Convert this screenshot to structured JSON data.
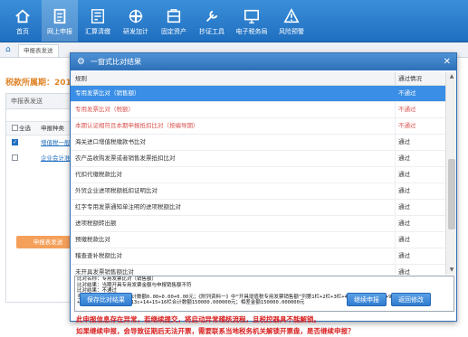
{
  "toolbar": {
    "items": [
      {
        "label": "首页",
        "icon": "home-icon"
      },
      {
        "label": "网上申报",
        "icon": "declare-icon",
        "active": true
      },
      {
        "label": "汇算清缴",
        "icon": "settlement-icon"
      },
      {
        "label": "研发加计",
        "icon": "rd-icon"
      },
      {
        "label": "固定资产",
        "icon": "asset-icon"
      },
      {
        "label": "抄证工具",
        "icon": "tools-icon"
      },
      {
        "label": "电子税务局",
        "icon": "etax-icon"
      },
      {
        "label": "风险预警",
        "icon": "warning-icon"
      }
    ]
  },
  "background": {
    "tab_label": "申报表发送",
    "period_label": "税款所属期：2018",
    "panel_title": "申报表发送",
    "select_all_label": "全选",
    "column_header": "申报种类",
    "rows": [
      {
        "text": "增值税一般纳",
        "checked": true
      },
      {
        "text": "企业会计准则",
        "checked": false
      }
    ],
    "declare_button": "申报表发送"
  },
  "modal": {
    "title": "一窗式比对结果",
    "header_rule": "规则",
    "header_status": "通过情况",
    "rows": [
      {
        "rule": "专用发票比对（销售额）",
        "status": "不通过",
        "fail": true,
        "selected": true
      },
      {
        "rule": "专用发票比对（税额）",
        "status": "不通过",
        "fail": true
      },
      {
        "rule": "本期认证相符且本期申报抵扣比对（按编导期）",
        "status": "不通过",
        "fail": true
      },
      {
        "rule": "海关进口增值税缴款书比对",
        "status": "通过"
      },
      {
        "rule": "农产品收购发票或者销售发票抵扣比对",
        "status": "通过"
      },
      {
        "rule": "代扣代缴税款比对",
        "status": "通过"
      },
      {
        "rule": "外贸企业进项税额抵扣证明比对",
        "status": "通过"
      },
      {
        "rule": "红字专用发票通知单注明的进项税额比对",
        "status": "通过"
      },
      {
        "rule": "进项税额转出额",
        "status": "通过"
      },
      {
        "rule": "预缴税款比对",
        "status": "通过"
      },
      {
        "rule": "稽查查补税额比对",
        "status": "通过"
      },
      {
        "rule": "未开具发票销售额比对",
        "status": "通过"
      }
    ],
    "detail_lines": [
      "比对名称：专用发票比对（销售额）",
      "比对结果：当期开具专用发票金额与申报销售额不符",
      "比对结果：不通过",
      "当期开具专用发票金额合计数额0.00+0.00+0.00元；《附列资料一》中“开具增值税专用发票销售额”列第1栏+2栏+3栏+4栏+5栏+6栏+8栏+9栏+10",
      "+10+11+12+13a+13b+13c+14+15+16栏合计数额150000.000000元；相差金额150000.000000元"
    ],
    "warning_lines": [
      "此申报信息存在异常，若继续提交，将启动异常稽核流程，且税控器具不能解锁。",
      "如果继续申报，会导致征期后无法开票，需要联系当地税务机关解锁开票盘，是否继续申报？"
    ],
    "buttons": {
      "save": "保存比对结果",
      "continue": "继续申报",
      "back": "返回修改"
    }
  }
}
